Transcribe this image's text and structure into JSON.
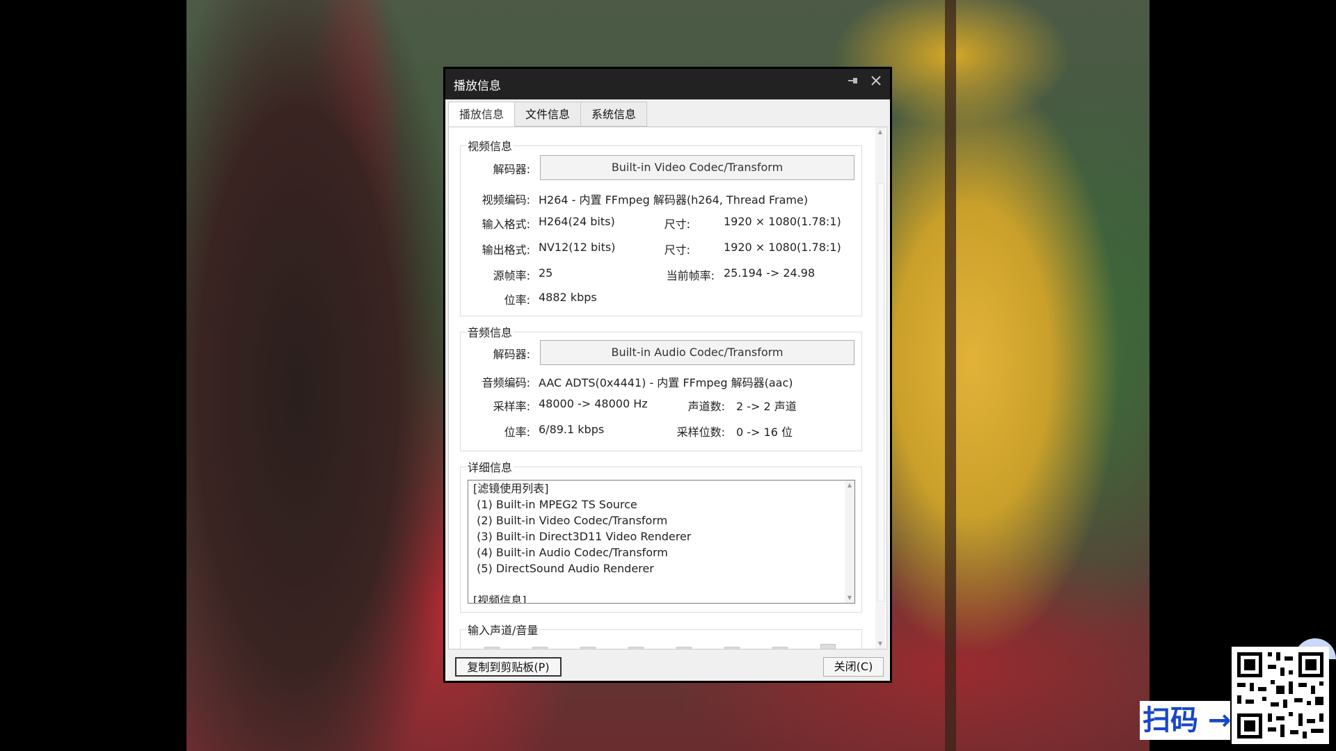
{
  "window": {
    "title": "播放信息"
  },
  "titlebar_icons": {
    "pin": "pin-icon",
    "close": "close-icon"
  },
  "tabs": [
    {
      "label": "播放信息",
      "active": true
    },
    {
      "label": "文件信息",
      "active": false
    },
    {
      "label": "系统信息",
      "active": false
    }
  ],
  "video_info": {
    "group_title": "视频信息",
    "decoder_label": "解码器:",
    "decoder_value": "Built-in Video Codec/Transform",
    "codec_label": "视频编码:",
    "codec_value": "H264 - 内置 FFmpeg 解码器(h264, Thread Frame)",
    "input_format_label": "输入格式:",
    "input_format_value": "H264(24 bits)",
    "input_size_label": "尺寸:",
    "input_size_value": "1920 × 1080(1.78:1)",
    "output_format_label": "输出格式:",
    "output_format_value": "NV12(12 bits)",
    "output_size_label": "尺寸:",
    "output_size_value": "1920 × 1080(1.78:1)",
    "source_fps_label": "源帧率:",
    "source_fps_value": "25",
    "current_fps_label": "当前帧率:",
    "current_fps_value": "25.194 -> 24.98",
    "bitrate_label": "位率:",
    "bitrate_value": "4882 kbps"
  },
  "audio_info": {
    "group_title": "音频信息",
    "decoder_label": "解码器:",
    "decoder_value": "Built-in Audio Codec/Transform",
    "codec_label": "音频编码:",
    "codec_value": "AAC ADTS(0x4441) - 内置 FFmpeg 解码器(aac)",
    "samplerate_label": "采样率:",
    "samplerate_value": "48000 -> 48000 Hz",
    "channels_label": "声道数:",
    "channels_value": "2 -> 2 声道",
    "bitrate_label": "位率:",
    "bitrate_value": "6/89.1 kbps",
    "bitdepth_label": "采样位数:",
    "bitdepth_value": "0 -> 16 位"
  },
  "details": {
    "group_title": "详细信息",
    "lines": [
      "[滤镜使用列表]",
      " (1) Built-in MPEG2 TS Source",
      " (2) Built-in Video Codec/Transform",
      " (3) Built-in Direct3D11 Video Renderer",
      " (4) Built-in Audio Codec/Transform",
      " (5) DirectSound Audio Renderer",
      "",
      "[视频信息]"
    ]
  },
  "input_channels": {
    "group_title": "输入声道/音量",
    "meter_count": 8
  },
  "footer": {
    "copy_label": "复制到剪贴板(P)",
    "close_label": "关闭(C)"
  },
  "overlay": {
    "scan_text": "扫码 →"
  },
  "colors": {
    "titlebar": "#222222",
    "scan_text": "#1846c8"
  }
}
